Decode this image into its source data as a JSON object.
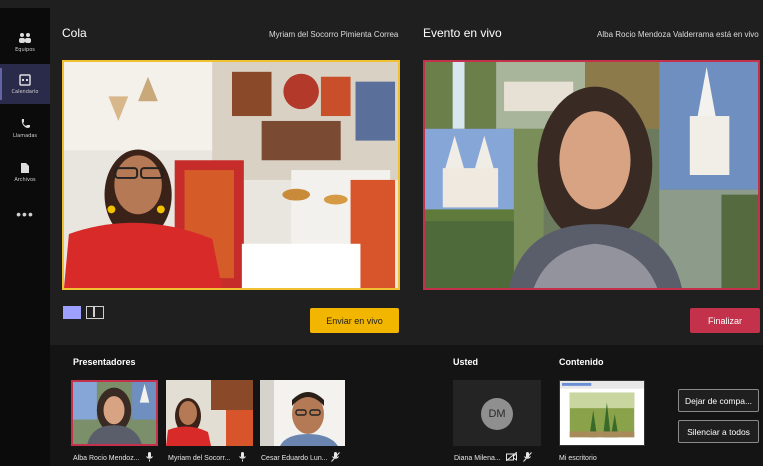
{
  "rail": {
    "items": [
      {
        "label": "Equipos",
        "icon": "teams-icon"
      },
      {
        "label": "Calendario",
        "icon": "calendar-icon",
        "active": true
      },
      {
        "label": "Llamadas",
        "icon": "phone-icon"
      },
      {
        "label": "Archivos",
        "icon": "file-icon"
      }
    ],
    "more": "•••"
  },
  "queue": {
    "title": "Cola",
    "presenter_name": "Myriam del Socorro Pimienta Correa",
    "send_live_label": "Enviar en vivo"
  },
  "live": {
    "title": "Evento en vivo",
    "status_text": "Alba Rocio Mendoza Valderrama está en vivo",
    "finish_label": "Finalizar"
  },
  "presenters": {
    "title": "Presentadores",
    "items": [
      {
        "name": "Alba Rocio Mendoz...",
        "mic": "mic-on"
      },
      {
        "name": "Myriam del Socorr...",
        "mic": "mic-on"
      },
      {
        "name": "Cesar Eduardo Lun...",
        "mic": "mic-off"
      }
    ]
  },
  "you": {
    "title": "Usted",
    "initials": "DM",
    "name": "Diana Milena..."
  },
  "content": {
    "title": "Contenido",
    "name": "Mi escritorio"
  },
  "actions": {
    "stop_sharing": "Dejar de compa...",
    "mute_all": "Silenciar a todos"
  },
  "colors": {
    "accent": "#6264a7",
    "queue_border": "#f0c030",
    "live_border": "#c4314b",
    "send_live_bg": "#f2b600",
    "finish_bg": "#c4314b"
  }
}
